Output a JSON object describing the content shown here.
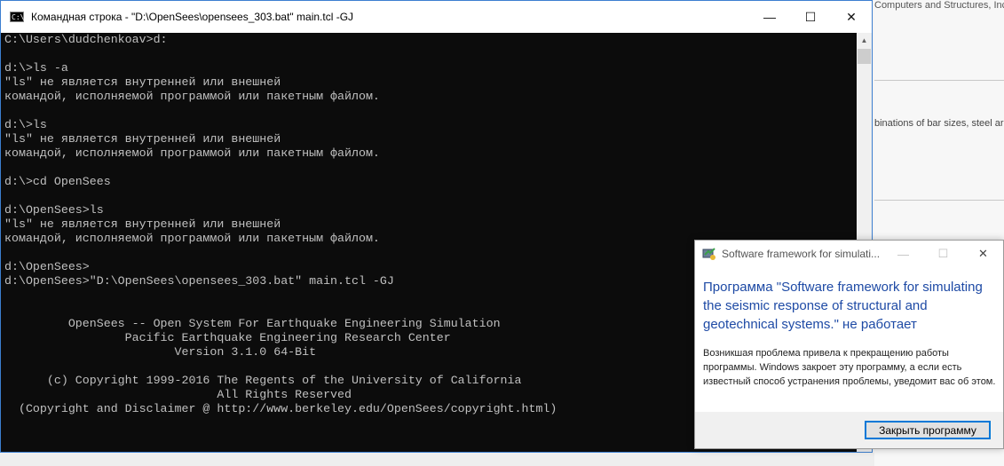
{
  "background": {
    "top_snippet": "Computers and Structures, Inc. is pleased to announce the release of CSiSteel. CSiSteel features a comprehensive library of steel sections and their structural properties, allowing users to",
    "mid_snippet": "binations of bar sizes, steel area"
  },
  "console": {
    "title": "Командная строка - \"D:\\OpenSees\\opensees_303.bat\"  main.tcl -GJ",
    "icon": "cmd-icon",
    "controls": {
      "minimize": "—",
      "maximize": "☐",
      "close": "✕"
    },
    "lines": [
      "C:\\Users\\dudchenkoav>d:",
      "",
      "d:\\>ls -a",
      "\"ls\" не является внутренней или внешней",
      "командой, исполняемой программой или пакетным файлом.",
      "",
      "d:\\>ls",
      "\"ls\" не является внутренней или внешней",
      "командой, исполняемой программой или пакетным файлом.",
      "",
      "d:\\>cd OpenSees",
      "",
      "d:\\OpenSees>ls",
      "\"ls\" не является внутренней или внешней",
      "командой, исполняемой программой или пакетным файлом.",
      "",
      "d:\\OpenSees>",
      "d:\\OpenSees>\"D:\\OpenSees\\opensees_303.bat\" main.tcl -GJ",
      "",
      "",
      "         OpenSees -- Open System For Earthquake Engineering Simulation",
      "                 Pacific Earthquake Engineering Research Center",
      "                        Version 3.1.0 64-Bit",
      "",
      "      (c) Copyright 1999-2016 The Regents of the University of California",
      "                              All Rights Reserved",
      "  (Copyright and Disclaimer @ http://www.berkeley.edu/OpenSees/copyright.html)"
    ]
  },
  "dialog": {
    "title": "Software framework for simulati...",
    "icon": "app-icon",
    "controls": {
      "minimize": "—",
      "maximize": "☐",
      "close": "✕"
    },
    "heading": "Программа \"Software framework for simulating the seismic response of structural and geotechnical systems.\" не работает",
    "message": "Возникшая проблема привела к прекращению работы программы. Windows закроет эту программу, а если есть известный способ устранения проблемы, уведомит вас об этом.",
    "button_label": "Закрыть программу",
    "accent": "#1e4aa5",
    "button_border": "#0078d7"
  }
}
